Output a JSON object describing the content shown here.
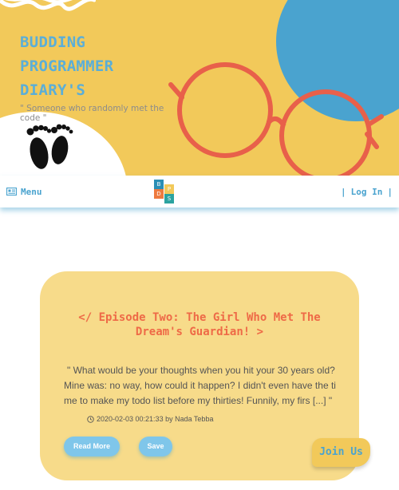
{
  "hero": {
    "title": "BUDDING PROGRAMMER DIARY'S",
    "tagline": "\" Someone who randomly met the code \"",
    "colors": {
      "background": "#f2c95a",
      "circle": "#4aa3cf",
      "glasses": "#e8604a",
      "title": "#5aaed8"
    },
    "icons": [
      "scribble-decoration",
      "glasses-illustration",
      "footprints-icon"
    ]
  },
  "navbar": {
    "menu_label": "Menu",
    "menu_icon": "newspaper-icon",
    "logo_letters": [
      "B",
      "D",
      "P",
      "S"
    ],
    "login_label": "Log In",
    "separator": "|"
  },
  "post": {
    "title": "</ Episode Two: The Girl Who Met The Dream's Guardian! >",
    "excerpt": "\" What would be your thoughts when you hit your 30 years old? Mine was: no way, how could it happen? I didn't even have the time to make my todo list before my thirties! Funnily, my firs [...] \"",
    "meta": "2020-02-03 00:21:33 by Nada Tebba",
    "read_more_label": "Read More",
    "save_label": "Save"
  },
  "join_label": "Join Us"
}
